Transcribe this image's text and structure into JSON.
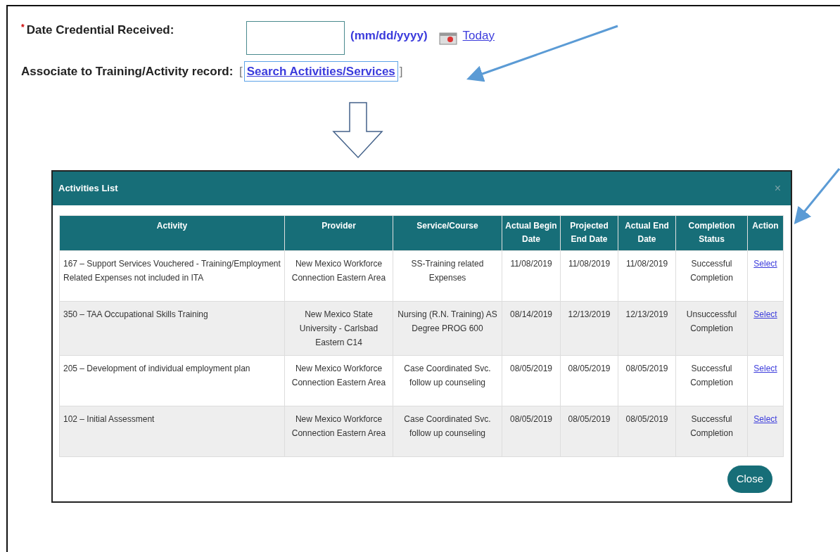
{
  "form": {
    "date_field": {
      "required_mark": "*",
      "label": "Date Credential Received:",
      "format_hint": "(mm/dd/yyyy)",
      "today_link": "Today"
    },
    "associate": {
      "label": "Associate to Training/Activity record:",
      "bracket_open": "[",
      "link": "Search Activities/Services",
      "focused": true,
      "bracket_close": "]"
    }
  },
  "modal": {
    "title": "Activities List",
    "close_icon": "×",
    "table": {
      "columns": [
        "Activity",
        "Provider",
        "Service/Course",
        "Actual Begin Date",
        "Projected End Date",
        "Actual End Date",
        "Completion Status",
        "Action"
      ],
      "rows": [
        {
          "cells": [
            "167 – Support Services Vouchered - Training/Employment Related Expenses not included in ITA",
            "New Mexico Workforce Connection Eastern Area",
            "SS-Training related Expenses",
            "11/08/2019",
            "11/08/2019",
            "11/08/2019",
            "Successful Completion"
          ],
          "action": "Select"
        },
        {
          "cells": [
            "350 – TAA Occupational Skills Training",
            "New Mexico State University - Carlsbad Eastern C14",
            "Nursing (R.N. Training) AS Degree PROG 600",
            "08/14/2019",
            "12/13/2019",
            "12/13/2019",
            "Unsuccessful Completion"
          ],
          "action": "Select"
        },
        {
          "cells": [
            "205 – Development of individual employment plan",
            "New Mexico Workforce Connection Eastern Area",
            "Case Coordinated Svc. follow up counseling",
            "08/05/2019",
            "08/05/2019",
            "08/05/2019",
            "Successful Completion"
          ],
          "action": "Select"
        },
        {
          "cells": [
            "102 – Initial Assessment",
            "New Mexico Workforce Connection Eastern Area",
            "Case Coordinated Svc. follow up counseling",
            "08/05/2019",
            "08/05/2019",
            "08/05/2019",
            "Successful Completion"
          ],
          "action": "Select"
        }
      ]
    },
    "close_button": "Close"
  }
}
